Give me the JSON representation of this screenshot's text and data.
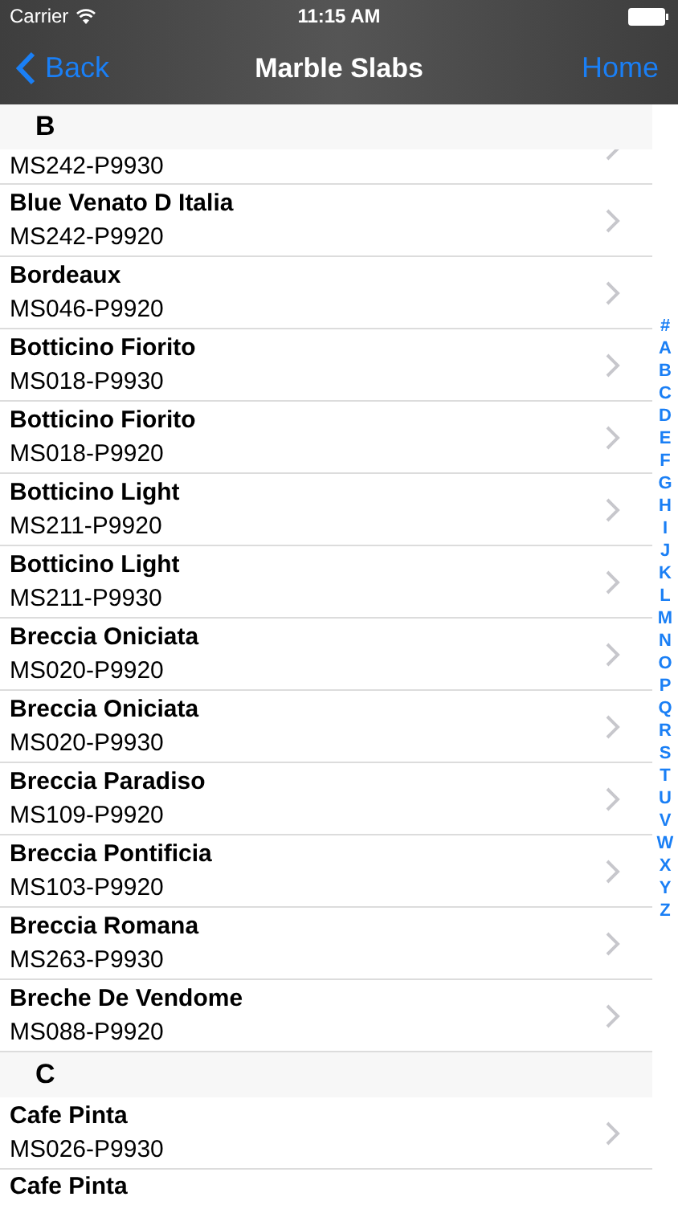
{
  "status_bar": {
    "carrier": "Carrier",
    "time": "11:15 AM"
  },
  "nav_bar": {
    "back": "Back",
    "title": "Marble Slabs",
    "right": "Home"
  },
  "sections": [
    {
      "header": "B",
      "rows": [
        {
          "kind": "cut_top",
          "code": "MS242-P9930"
        },
        {
          "kind": "full",
          "name": "Blue Venato D Italia",
          "code": "MS242-P9920"
        },
        {
          "kind": "full",
          "name": "Bordeaux",
          "code": "MS046-P9920"
        },
        {
          "kind": "full",
          "name": "Botticino Fiorito",
          "code": "MS018-P9930"
        },
        {
          "kind": "full",
          "name": "Botticino Fiorito",
          "code": "MS018-P9920"
        },
        {
          "kind": "full",
          "name": "Botticino Light",
          "code": "MS211-P9920"
        },
        {
          "kind": "full",
          "name": "Botticino Light",
          "code": "MS211-P9930"
        },
        {
          "kind": "full",
          "name": "Breccia Oniciata",
          "code": "MS020-P9920"
        },
        {
          "kind": "full",
          "name": "Breccia Oniciata",
          "code": "MS020-P9930"
        },
        {
          "kind": "full",
          "name": "Breccia Paradiso",
          "code": "MS109-P9920"
        },
        {
          "kind": "full",
          "name": "Breccia Pontificia",
          "code": "MS103-P9920"
        },
        {
          "kind": "full",
          "name": "Breccia Romana",
          "code": "MS263-P9930"
        },
        {
          "kind": "full",
          "name": "Breche De Vendome",
          "code": "MS088-P9920"
        }
      ]
    },
    {
      "header": "C",
      "rows": [
        {
          "kind": "full",
          "name": "Cafe Pinta",
          "code": "MS026-P9930"
        },
        {
          "kind": "cut_bottom",
          "name": "Cafe Pinta"
        }
      ]
    }
  ],
  "index": [
    "#",
    "A",
    "B",
    "C",
    "D",
    "E",
    "F",
    "G",
    "H",
    "I",
    "J",
    "K",
    "L",
    "M",
    "N",
    "O",
    "P",
    "Q",
    "R",
    "S",
    "T",
    "U",
    "V",
    "W",
    "X",
    "Y",
    "Z"
  ]
}
